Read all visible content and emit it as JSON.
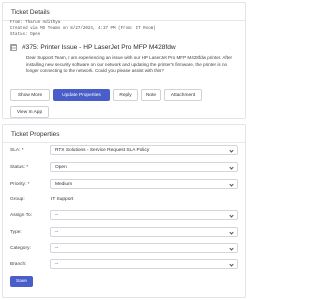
{
  "ticket_details": {
    "heading": "Ticket Details",
    "meta": {
      "from": "From: Tharun Adithya",
      "created": "Created via MS Teams on 8/27/2024, 4:37 PM (From: IT Room)",
      "status": "Status: Open"
    },
    "subject": "#375: Printer Issue - HP LaserJet Pro MFP M428fdw",
    "description": "Dear Support Team, I am experiencing an issue with our HP LaserJet Pro MFP M428fdw printer. After installing new security software on our network and updating the printer's firmware, the printer is no longer connecting to the network. Could you please assist with this?",
    "buttons": {
      "show_more": "Show More",
      "update_properties": "Update Properties",
      "reply": "Reply",
      "note": "Note",
      "attachment": "Attachment",
      "view_in_app": "View In App"
    }
  },
  "ticket_properties": {
    "heading": "Ticket Properties",
    "fields": {
      "sla_label": "SLA: *",
      "sla_value": "RTX Solutions - Service Request SLA Policy",
      "status_label": "Status: *",
      "status_value": "Open",
      "priority_label": "Priority: *",
      "priority_value": "Medium",
      "group_label": "Group:",
      "group_value": "IT Support",
      "assign_label": "Assign To:",
      "assign_value": "--",
      "type_label": "Type:",
      "type_value": "--",
      "category_label": "Category:",
      "category_value": "--",
      "branch_label": "Branch:",
      "branch_value": "--"
    },
    "save_label": "Save"
  }
}
